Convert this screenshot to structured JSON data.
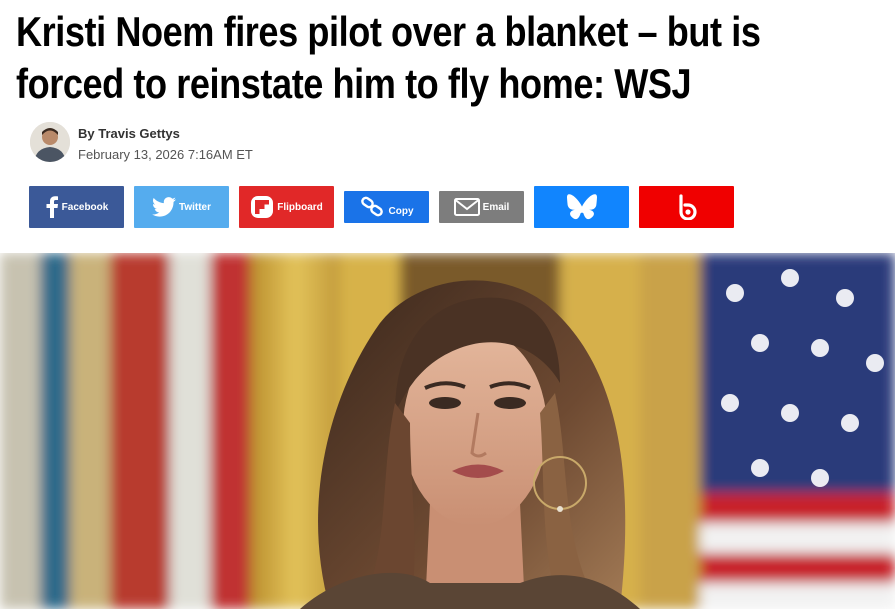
{
  "headline": {
    "line1": "Kristi Noem fires pilot over a blanket – but is",
    "line2": "forced to reinstate him to fly home: WSJ"
  },
  "byline": {
    "author": "By Travis Gettys",
    "date": "February 13, 2026 7:16AM ET",
    "avatar_icon": "author-avatar"
  },
  "share": {
    "facebook": {
      "label": "Facebook",
      "color": "#3b5998",
      "icon": "facebook-icon"
    },
    "twitter": {
      "label": "Twitter",
      "color": "#55acee",
      "icon": "twitter-bird-icon"
    },
    "flipboard": {
      "label": "Flipboard",
      "color": "#e12828",
      "icon": "flipboard-icon"
    },
    "copy": {
      "label": "Copy",
      "color": "#1a73e8",
      "icon": "link-icon"
    },
    "email": {
      "label": "Email",
      "color": "#7d7d7d",
      "icon": "envelope-icon"
    },
    "bluesky": {
      "label": "",
      "color": "#1185fe",
      "icon": "butterfly-icon"
    },
    "other": {
      "label": "",
      "color": "#f00000",
      "icon": "b-logo-icon"
    }
  },
  "hero": {
    "icon": "hero-photo",
    "colors": {
      "flag_blue": "#2a3a7a",
      "flag_red": "#c8202c",
      "backdrop_gold": "#d8b24a"
    }
  }
}
